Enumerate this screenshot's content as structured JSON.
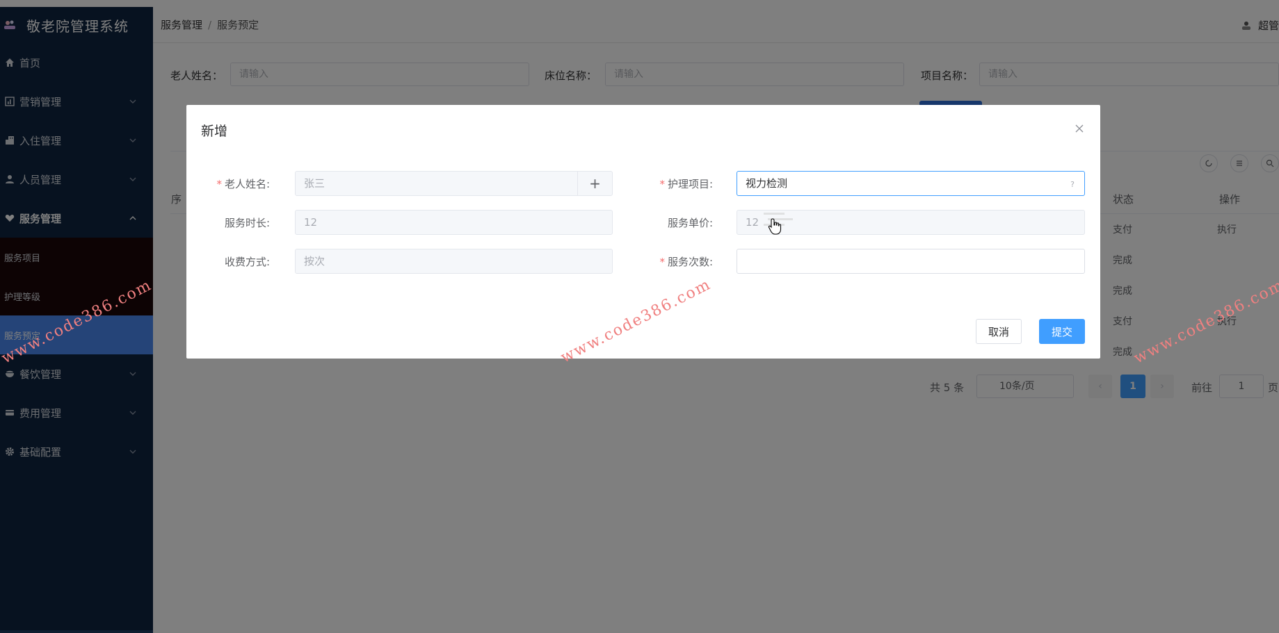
{
  "app": {
    "title": "敬老院管理系统"
  },
  "sidebar": {
    "items": [
      {
        "label": "首页",
        "icon": "home-icon"
      },
      {
        "label": "营销管理",
        "icon": "chart-icon"
      },
      {
        "label": "入住管理",
        "icon": "building-icon"
      },
      {
        "label": "人员管理",
        "icon": "user-icon"
      },
      {
        "label": "服务管理",
        "icon": "heart-hand-icon"
      },
      {
        "label": "餐饮管理",
        "icon": "bowl-icon"
      },
      {
        "label": "费用管理",
        "icon": "card-icon"
      },
      {
        "label": "基础配置",
        "icon": "gear-icon"
      }
    ],
    "submenu": [
      "服务项目",
      "护理等级",
      "服务预定"
    ]
  },
  "header": {
    "breadcrumb": [
      "服务管理",
      "服务预定"
    ],
    "user_text": "超管"
  },
  "search": {
    "elder_label": "老人姓名：",
    "bed_label": "床位名称：",
    "item_label": "项目名称：",
    "placeholder": "请输入"
  },
  "table": {
    "status_header": "状态",
    "op_header": "操作",
    "rows": [
      {
        "status": "支付",
        "op": "执行"
      },
      {
        "status": "完成",
        "op": ""
      },
      {
        "status": "完成",
        "op": ""
      },
      {
        "status": "支付",
        "op": "执行"
      },
      {
        "status": "完成",
        "op": ""
      }
    ],
    "first_col_partial": "序"
  },
  "pagination": {
    "total": "共 5 条",
    "page_size": "10条/页",
    "current": "1",
    "goto_label": "前往",
    "goto_value": "1",
    "page_suffix": "页"
  },
  "dialog": {
    "title": "新增",
    "fields": {
      "elder_name": {
        "label": "老人姓名:",
        "value": "张三",
        "required": true
      },
      "nursing_item": {
        "label": "护理项目:",
        "value": "视力检测",
        "required": true,
        "hint": "?"
      },
      "duration": {
        "label": "服务时长:",
        "value": "12"
      },
      "unit_price": {
        "label": "服务单价:",
        "value": "12"
      },
      "charge_mode": {
        "label": "收费方式:",
        "value": "按次"
      },
      "count": {
        "label": "服务次数:",
        "value": "",
        "required": true
      }
    },
    "cancel_label": "取消",
    "submit_label": "提交",
    "required_mark": "*",
    "plus_label": "+"
  },
  "watermark": "www.code386.com",
  "colors": {
    "sidebar_bg": "#0f2540",
    "active_blue": "#4a88f0",
    "primary": "#409eff",
    "required": "#f56c6c",
    "watermark": "#f08080"
  }
}
